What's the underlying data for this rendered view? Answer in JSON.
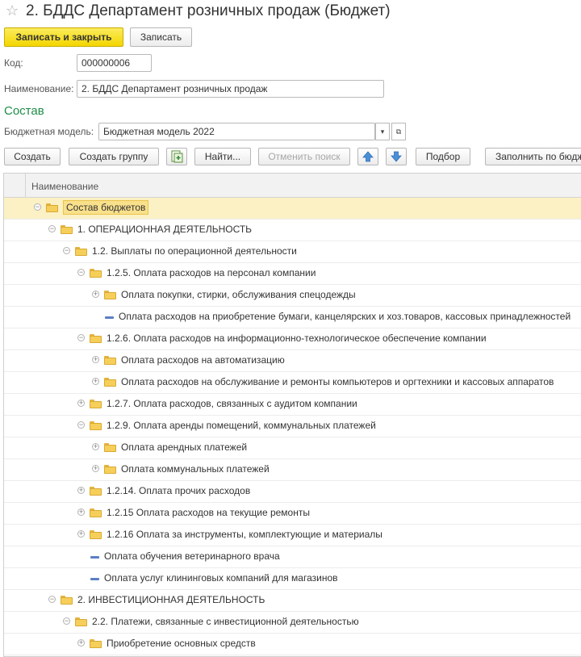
{
  "window": {
    "title": "2. БДДС Департамент розничных продаж (Бюджет)"
  },
  "toolbar": {
    "save_close": "Записать и закрыть",
    "save": "Записать"
  },
  "form": {
    "code_label": "Код:",
    "code_value": "000000006",
    "name_label": "Наименование:",
    "name_value": "2. БДДС Департамент розничных продаж",
    "section_title": "Состав",
    "model_label": "Бюджетная модель:",
    "model_value": "Бюджетная модель 2022"
  },
  "list_toolbar": {
    "create": "Создать",
    "create_group": "Создать группу",
    "find": "Найти...",
    "cancel_search": "Отменить поиск",
    "pick": "Подбор",
    "fill": "Заполнить по бюджету"
  },
  "table": {
    "header": "Наименование",
    "rows": [
      {
        "text": "Состав бюджетов"
      },
      {
        "text": "1. ОПЕРАЦИОННАЯ ДЕЯТЕЛЬНОСТЬ"
      },
      {
        "text": "1.2. Выплаты по операционной деятельности"
      },
      {
        "text": "1.2.5. Оплата расходов на персонал компании"
      },
      {
        "text": "Оплата покупки, стирки, обслуживания спецодежды"
      },
      {
        "text": "Оплата расходов на приобретение бумаги, канцелярских и хоз.товаров, кассовых принадлежностей"
      },
      {
        "text": "1.2.6. Оплата расходов на информационно-технологическое обеспечение компании"
      },
      {
        "text": "Оплата расходов на автоматизацию"
      },
      {
        "text": "Оплата расходов на обслуживание и ремонты компьютеров и оргтехники и кассовых аппаратов"
      },
      {
        "text": "1.2.7. Оплата расходов, связанных с аудитом компании"
      },
      {
        "text": "1.2.9. Оплата аренды помещений, коммунальных платежей"
      },
      {
        "text": "Оплата арендных платежей"
      },
      {
        "text": "Оплата коммунальных платежей"
      },
      {
        "text": "1.2.14. Оплата прочих расходов"
      },
      {
        "text": "1.2.15 Оплата расходов на текущие ремонты"
      },
      {
        "text": "1.2.16 Оплата за инструменты, комплектующие и материалы"
      },
      {
        "text": "Оплата обучения ветеринарного врача"
      },
      {
        "text": "Оплата услуг клининговых компаний для магазинов"
      },
      {
        "text": "2. ИНВЕСТИЦИОННАЯ ДЕЯТЕЛЬНОСТЬ"
      },
      {
        "text": "2.2. Платежи, связанные с инвестиционной деятельностью"
      },
      {
        "text": "Приобретение основных средств"
      }
    ]
  }
}
